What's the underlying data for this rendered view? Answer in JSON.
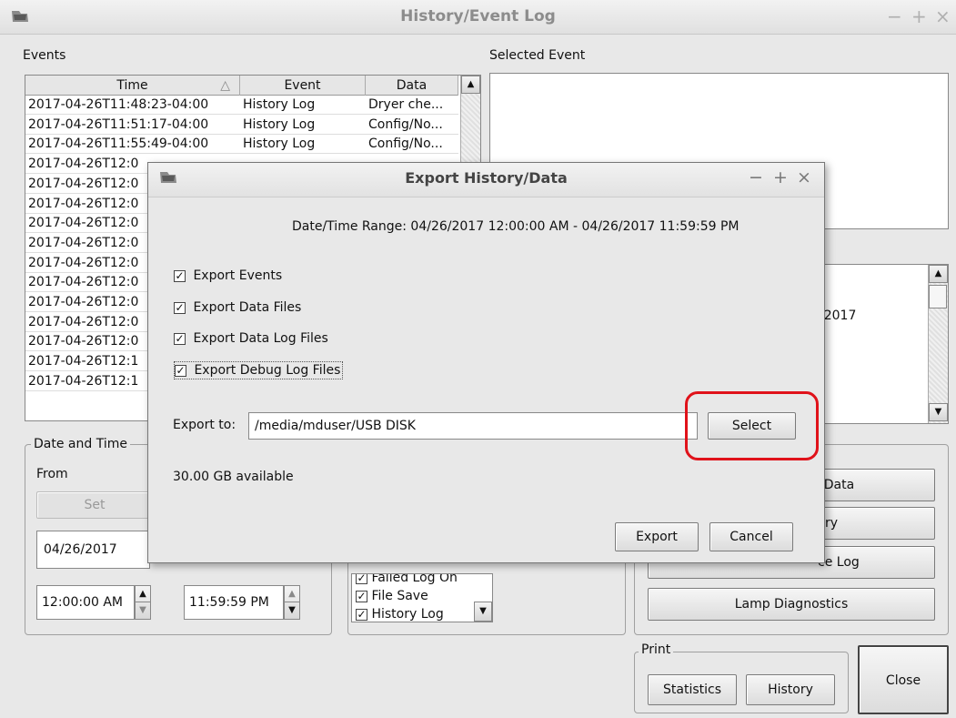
{
  "window": {
    "title": "History/Event Log",
    "controls": [
      "−",
      "+",
      "×"
    ]
  },
  "events": {
    "label": "Events",
    "columns": [
      "Time",
      "Event",
      "Data"
    ],
    "rows": [
      {
        "time": "2017-04-26T11:48:23-04:00",
        "event": "History Log",
        "data": "Dryer che..."
      },
      {
        "time": "2017-04-26T11:51:17-04:00",
        "event": "History Log",
        "data": "Config/No..."
      },
      {
        "time": "2017-04-26T11:55:49-04:00",
        "event": "History Log",
        "data": "Config/No..."
      },
      {
        "time": "2017-04-26T12:0",
        "event": "",
        "data": ""
      },
      {
        "time": "2017-04-26T12:0",
        "event": "",
        "data": ""
      },
      {
        "time": "2017-04-26T12:0",
        "event": "",
        "data": ""
      },
      {
        "time": "2017-04-26T12:0",
        "event": "",
        "data": ""
      },
      {
        "time": "2017-04-26T12:0",
        "event": "",
        "data": ""
      },
      {
        "time": "2017-04-26T12:0",
        "event": "",
        "data": ""
      },
      {
        "time": "2017-04-26T12:0",
        "event": "",
        "data": ""
      },
      {
        "time": "2017-04-26T12:0",
        "event": "",
        "data": ""
      },
      {
        "time": "2017-04-26T12:0",
        "event": "",
        "data": ""
      },
      {
        "time": "2017-04-26T12:0",
        "event": "",
        "data": ""
      },
      {
        "time": "2017-04-26T12:1",
        "event": "",
        "data": ""
      },
      {
        "time": "2017-04-26T12:1",
        "event": "",
        "data": ""
      }
    ]
  },
  "selected_event": {
    "label": "Selected Event",
    "partial_text": "/2017"
  },
  "date_time": {
    "label": "Date and Time",
    "from_label": "From",
    "set_label": "Set",
    "from_date": "04/26/2017",
    "from_time": "12:00:00 AM",
    "to_time": "11:59:59 PM"
  },
  "filters": {
    "items": [
      {
        "label": "Failed Log On",
        "checked": true
      },
      {
        "label": "File Save",
        "checked": true
      },
      {
        "label": "History Log",
        "checked": true
      }
    ]
  },
  "actions": {
    "export_data": "/Data",
    "history": "ry",
    "service_log": "ce Log",
    "lamp_diagnostics": "Lamp Diagnostics"
  },
  "print": {
    "label": "Print",
    "statistics": "Statistics",
    "history": "History"
  },
  "close_label": "Close",
  "dialog": {
    "title": "Export History/Data",
    "controls": [
      "−",
      "+",
      "×"
    ],
    "range_text": "Date/Time Range:  04/26/2017 12:00:00 AM - 04/26/2017 11:59:59 PM",
    "options": [
      {
        "label": "Export Events",
        "checked": true
      },
      {
        "label": "Export Data Files",
        "checked": true
      },
      {
        "label": "Export Data Log Files",
        "checked": true
      },
      {
        "label": "Export Debug Log Files",
        "checked": true
      }
    ],
    "export_to_label": "Export to:",
    "export_path": "/media/mduser/USB DISK",
    "select_label": "Select",
    "available": "30.00 GB available",
    "export_label": "Export",
    "cancel_label": "Cancel",
    "highlight_color": "#e0121a"
  }
}
